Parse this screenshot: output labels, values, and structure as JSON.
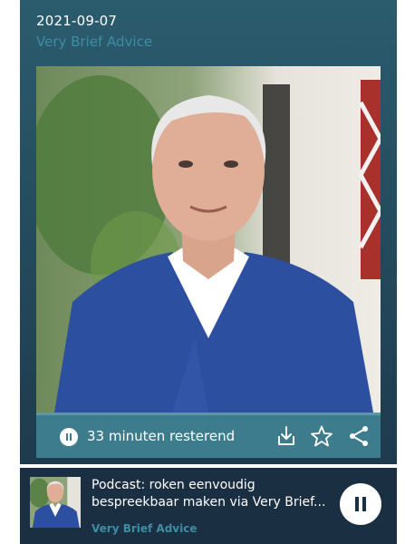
{
  "episode": {
    "date": "2021-09-07",
    "show_name": "Very Brief Advice",
    "progress_fraction": 0.0
  },
  "controls": {
    "remaining_text": "33 minuten resterend",
    "icons": [
      "pause-icon",
      "download-icon",
      "star-icon",
      "share-icon"
    ]
  },
  "mini_player": {
    "title_line1": "Podcast: roken eenvoudig",
    "title_line2": "bespreekbaar maken via Very Brief...",
    "show_name": "Very Brief Advice",
    "button_icon": "pause-icon"
  },
  "colors": {
    "accent": "#3d8ea3",
    "card_top": "#2b5c6e",
    "mini_player_bg": "#1b2f43"
  }
}
